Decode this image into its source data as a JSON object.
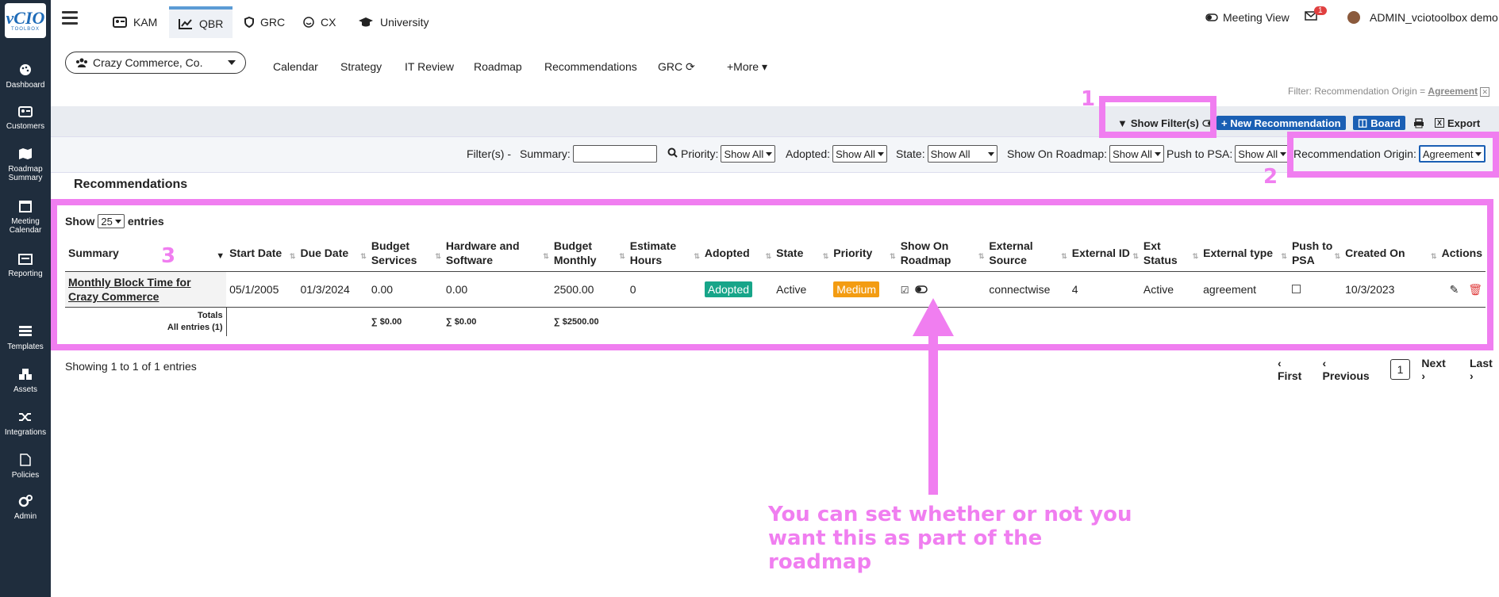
{
  "sidebar": {
    "logo_text": "vCIO",
    "logo_sub": "TOOLBOX",
    "items": [
      {
        "label": "Dashboard",
        "icon": "palette-icon"
      },
      {
        "label": "Customers",
        "icon": "id-card-icon"
      },
      {
        "label": "Roadmap Summary",
        "icon": "map-icon"
      },
      {
        "label": "Meeting Calendar",
        "icon": "calendar-icon"
      },
      {
        "label": "Reporting",
        "icon": "report-icon"
      },
      {
        "label": "Templates",
        "icon": "templates-icon"
      },
      {
        "label": "Assets",
        "icon": "cubes-icon"
      },
      {
        "label": "Integrations",
        "icon": "shuffle-icon"
      },
      {
        "label": "Policies",
        "icon": "file-icon"
      },
      {
        "label": "Admin",
        "icon": "cogs-icon"
      }
    ]
  },
  "topnav": {
    "tabs": [
      {
        "label": "KAM",
        "icon": "id-card-icon"
      },
      {
        "label": "QBR",
        "icon": "chart-line-icon",
        "active": true
      },
      {
        "label": "GRC",
        "icon": "shield-icon"
      },
      {
        "label": "CX",
        "icon": "smile-icon"
      },
      {
        "label": "University",
        "icon": "graduation-cap-icon"
      }
    ],
    "meeting_view": "Meeting View",
    "mail_count": "1",
    "user": "ADMIN_vciotoolbox demo"
  },
  "subnav": {
    "company": "Crazy Commerce, Co.",
    "links": [
      "Calendar",
      "Strategy",
      "IT Review",
      "Roadmap",
      "Recommendations",
      "GRC",
      "+More"
    ]
  },
  "filter_status": {
    "prefix": "Filter: Recommendation Origin = ",
    "value": "Agreement"
  },
  "toolbar": {
    "show_filters": "Show Filter(s)",
    "new_recommendation": "+ New Recommendation",
    "board": "Board",
    "export": "Export"
  },
  "filters": {
    "label": "Filter(s) -",
    "summary_label": "Summary:",
    "summary_value": "",
    "priority_label": "Priority:",
    "priority_value": "Show All",
    "adopted_label": "Adopted:",
    "adopted_value": "Show All",
    "state_label": "State:",
    "state_value": "Show All",
    "roadmap_label": "Show On Roadmap:",
    "roadmap_value": "Show All",
    "psa_label": "Push to PSA:",
    "psa_value": "Show All",
    "origin_label": "Recommendation Origin:",
    "origin_value": "Agreement"
  },
  "section_title": "Recommendations",
  "entries": {
    "show": "Show",
    "count": "25",
    "suffix": "entries"
  },
  "table": {
    "headers": [
      "Summary",
      "Start Date",
      "Due Date",
      "Budget Services",
      "Hardware and Software",
      "Budget Monthly",
      "Estimate Hours",
      "Adopted",
      "State",
      "Priority",
      "Show On Roadmap",
      "External Source",
      "External ID",
      "Ext Status",
      "External type",
      "Push to PSA",
      "Created On",
      "Actions"
    ],
    "row": {
      "summary": "Monthly Block Time for Crazy Commerce",
      "start": "05/1/2005",
      "due": "01/3/2024",
      "budget_services": "0.00",
      "hw_sw": "0.00",
      "budget_monthly": "2500.00",
      "hours": "0",
      "adopted": "Adopted",
      "state": "Active",
      "priority": "Medium",
      "ext_source": "connectwise",
      "ext_id": "4",
      "ext_status": "Active",
      "ext_type": "agreement",
      "created": "10/3/2023"
    },
    "totals": {
      "label1": "Totals",
      "label2": "All entries (1)",
      "services": "∑ $0.00",
      "hw": "∑ $0.00",
      "monthly": "∑ $2500.00"
    }
  },
  "showing": "Showing 1 to 1 of 1 entries",
  "pager": {
    "first": "First",
    "previous": "Previous",
    "page": "1",
    "next": "Next",
    "last": "Last"
  },
  "annotations": {
    "n1": "1",
    "n2": "2",
    "n3": "3",
    "callout": "You can set whether or not you want this as part of the roadmap",
    "color": "#f07ef0"
  }
}
